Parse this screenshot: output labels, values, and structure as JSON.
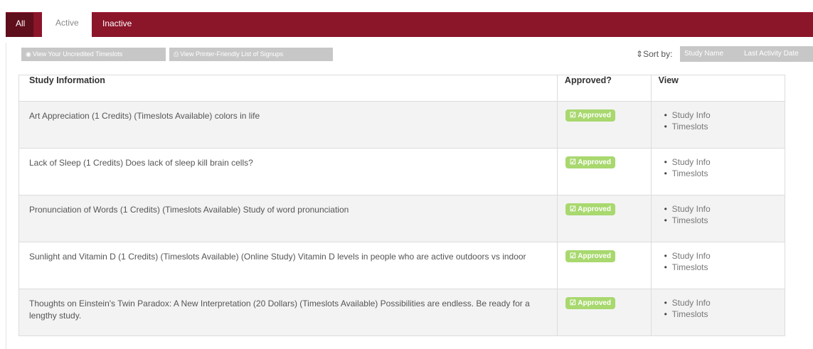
{
  "tabs": {
    "all": "All",
    "active": "Active",
    "inactive": "Inactive"
  },
  "actions": {
    "uncredited": "View Your Uncredited Timeslots",
    "printer": "View Printer-Friendly List of Signups"
  },
  "sort": {
    "label": "Sort by:",
    "study_name": "Study Name",
    "last_activity": "Last Activity Date"
  },
  "table": {
    "headers": {
      "info": "Study Information",
      "approved": "Approved?",
      "view": "View"
    },
    "rows": [
      {
        "info": "Art Appreciation (1 Credits) (Timeslots Available) colors in life",
        "status": "Approved",
        "links": [
          "Study Info",
          "Timeslots"
        ]
      },
      {
        "info": "Lack of Sleep (1 Credits) Does lack of sleep kill brain cells?",
        "status": "Approved",
        "links": [
          "Study Info",
          "Timeslots"
        ]
      },
      {
        "info": "Pronunciation of Words (1 Credits) (Timeslots Available) Study of word pronunciation",
        "status": "Approved",
        "links": [
          "Study Info",
          "Timeslots"
        ]
      },
      {
        "info": "Sunlight and Vitamin D (1 Credits) (Timeslots Available) (Online Study) Vitamin D levels in people who are active outdoors vs indoor",
        "status": "Approved",
        "links": [
          "Study Info",
          "Timeslots"
        ]
      },
      {
        "info": "Thoughts on Einstein's Twin Paradox: A New Interpretation (20 Dollars) (Timeslots Available) Possibilities are endless. Be ready for a lengthy study.",
        "status": "Approved",
        "links": [
          "Study Info",
          "Timeslots"
        ]
      }
    ]
  },
  "colors": {
    "tab_bar": "#8b1529",
    "tab_all": "#5f0e1c",
    "approved_badge": "#a8d86e",
    "button_gray": "#c7c7c7"
  },
  "icons": {
    "uncredited": "eye-icon",
    "printer": "printer-icon",
    "sort": "sort-icon",
    "approved": "check-square-icon"
  }
}
